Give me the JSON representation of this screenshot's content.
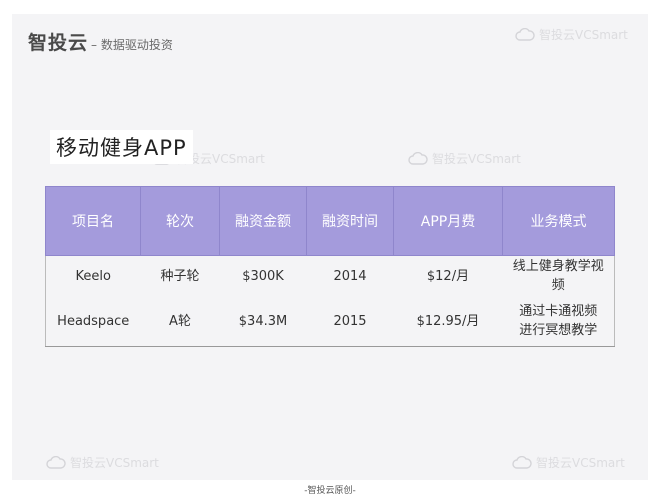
{
  "header": {
    "brand_name": "智投云",
    "brand_tagline": "– 数据驱动投资"
  },
  "watermark_text": "智投云VCSmart",
  "section_title": "移动健身APP",
  "table": {
    "columns": [
      "项目名",
      "轮次",
      "融资金额",
      "融资时间",
      "APP月费",
      "业务模式"
    ],
    "rows": [
      [
        "Keelo",
        "种子轮",
        "$300K",
        "2014",
        "$12/月",
        "线上健身教学视频"
      ],
      [
        "Headspace",
        "A轮",
        "$34.3M",
        "2015",
        "$12.95/月",
        "通过卡通视频进行冥想教学"
      ]
    ]
  },
  "footer_text": "-智投云原创-",
  "colors": {
    "header_bg": "#a49bdc",
    "slide_bg": "#f4f4f6"
  }
}
